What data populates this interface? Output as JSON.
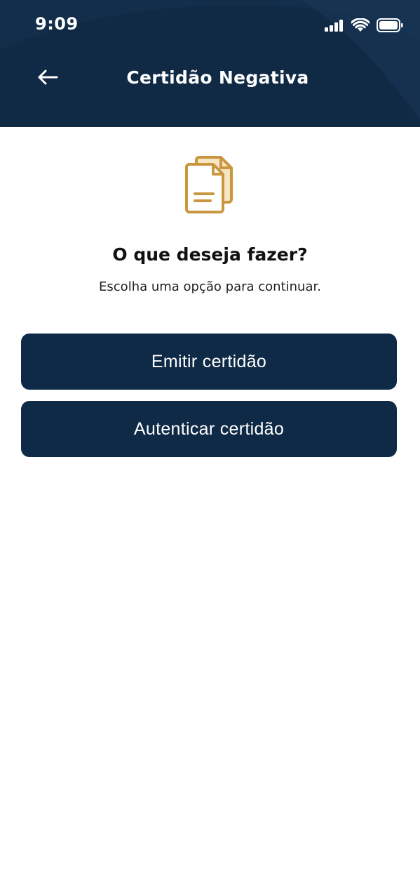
{
  "status_bar": {
    "time": "9:09",
    "icons": [
      "signal-icon",
      "wifi-icon",
      "battery-icon"
    ]
  },
  "header": {
    "title": "Certidão Negativa",
    "back_icon": "arrow-left-icon",
    "background_color": "#102a46"
  },
  "main": {
    "icon": "documents-icon",
    "icon_color": "#c9973f",
    "question": "O que deseja fazer?",
    "subtitle": "Escolha uma opção para continuar.",
    "buttons": [
      {
        "label": "Emitir certidão"
      },
      {
        "label": "Autenticar certidão"
      }
    ],
    "button_color": "#0f2a46"
  }
}
